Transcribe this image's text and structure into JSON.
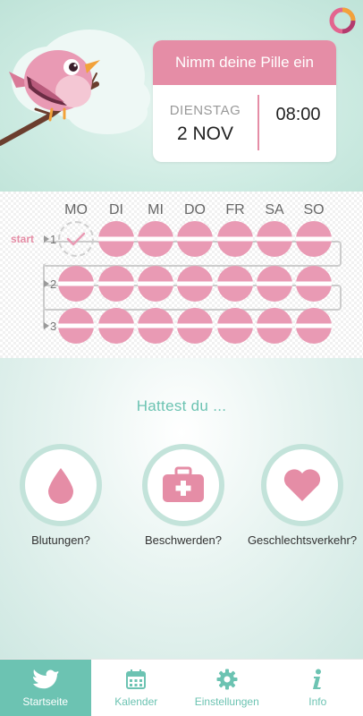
{
  "reminder": {
    "title": "Nimm deine Pille ein",
    "weekday": "DIENSTAG",
    "date": "2 NOV",
    "time": "08:00"
  },
  "pill_grid": {
    "days": [
      "MO",
      "DI",
      "MI",
      "DO",
      "FR",
      "SA",
      "SO"
    ],
    "start_label": "start",
    "rows": [
      {
        "number": "1",
        "pills": [
          "taken",
          "pending",
          "pending",
          "pending",
          "pending",
          "pending",
          "pending"
        ]
      },
      {
        "number": "2",
        "pills": [
          "pending",
          "pending",
          "pending",
          "pending",
          "pending",
          "pending",
          "pending"
        ]
      },
      {
        "number": "3",
        "pills": [
          "pending",
          "pending",
          "pending",
          "pending",
          "pending",
          "pending",
          "pending"
        ]
      }
    ]
  },
  "questions": {
    "title": "Hattest du ...",
    "items": [
      {
        "label": "Blutungen?",
        "icon": "blood-drop-icon"
      },
      {
        "label": "Beschwerden?",
        "icon": "first-aid-kit-icon"
      },
      {
        "label": "Geschlechtsverkehr?",
        "icon": "heart-icon"
      }
    ]
  },
  "nav": {
    "items": [
      {
        "label": "Startseite",
        "icon": "bird-icon",
        "active": true
      },
      {
        "label": "Kalender",
        "icon": "calendar-icon",
        "active": false
      },
      {
        "label": "Einstellungen",
        "icon": "gear-icon",
        "active": false
      },
      {
        "label": "Info",
        "icon": "info-icon",
        "active": false
      }
    ]
  },
  "colors": {
    "accent_pink": "#e58da6",
    "pill_pink": "#e99ab4",
    "accent_teal": "#6cc3b2",
    "header_mint": "#cdebe2"
  }
}
